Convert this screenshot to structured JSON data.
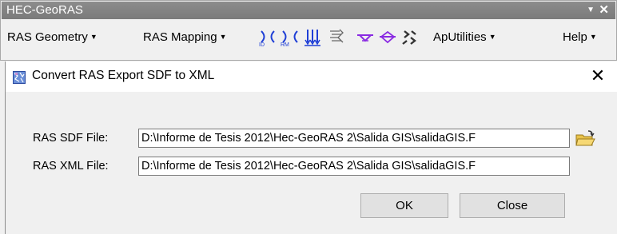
{
  "toolbar": {
    "title": "HEC-GeoRAS",
    "menus": {
      "ras_geometry": "RAS Geometry",
      "ras_mapping": "RAS Mapping",
      "aputilities": "ApUtilities",
      "help": "Help"
    },
    "icons": {
      "xs_cut_line_id": "ID",
      "xs_river_mile": "RM"
    }
  },
  "dialog": {
    "title": "Convert RAS Export SDF to XML",
    "sdf_label": "RAS SDF File:",
    "sdf_value": "D:\\Informe de Tesis 2012\\Hec-GeoRAS 2\\Salida GIS\\salidaGIS.F",
    "xml_label": "RAS XML File:",
    "xml_value": "D:\\Informe de Tesis 2012\\Hec-GeoRAS 2\\Salida GIS\\salidaGIS.F",
    "ok_label": "OK",
    "close_label": "Close"
  },
  "colors": {
    "toolbar_title_bg": "#808080",
    "icon_blue": "#1f3fd6",
    "icon_purple": "#8a2be2",
    "folder_yellow": "#e8c24a"
  }
}
